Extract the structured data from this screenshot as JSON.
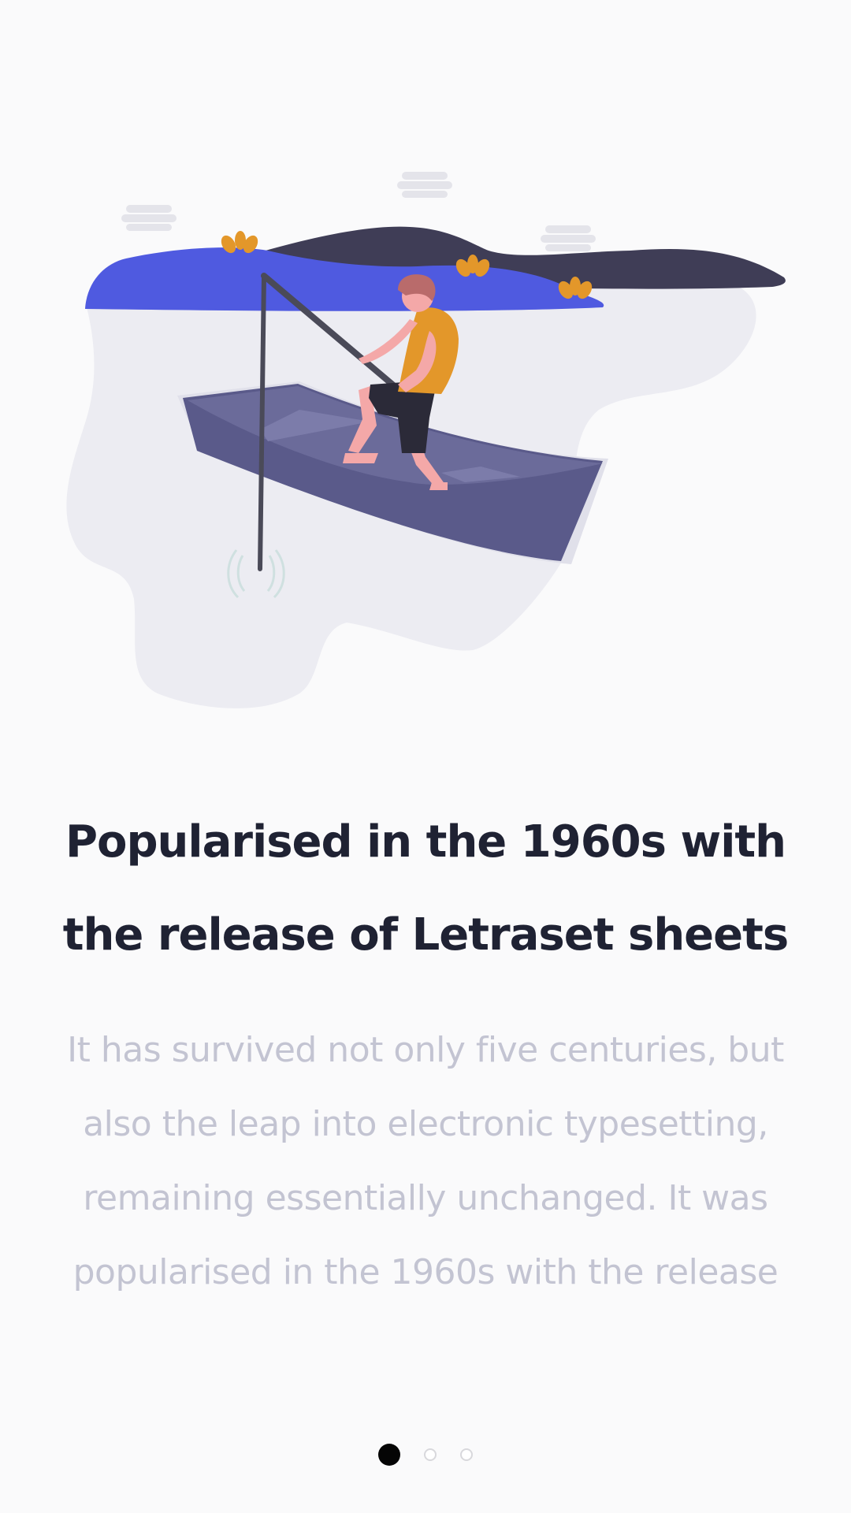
{
  "onboarding": {
    "title": "Popularised in the 1960s with the release of Letraset sheets",
    "description": "It has survived not only five centuries, but also the leap into electronic typesetting, remaining essentially unchanged. It was popularised in the 1960s with the release",
    "pager": {
      "total_pages": 3,
      "current_page": 1
    }
  },
  "colors": {
    "background": "#fafafb",
    "title": "#1f2233",
    "description": "#c3c4d2",
    "dot_active": "#050505",
    "dot_inactive_border": "#d8d8dc",
    "land_blue": "#4f5ae0",
    "land_dark": "#3f3d56",
    "boat": "#5a5a8a",
    "shirt": "#e3972a",
    "blob": "#ececf2"
  }
}
